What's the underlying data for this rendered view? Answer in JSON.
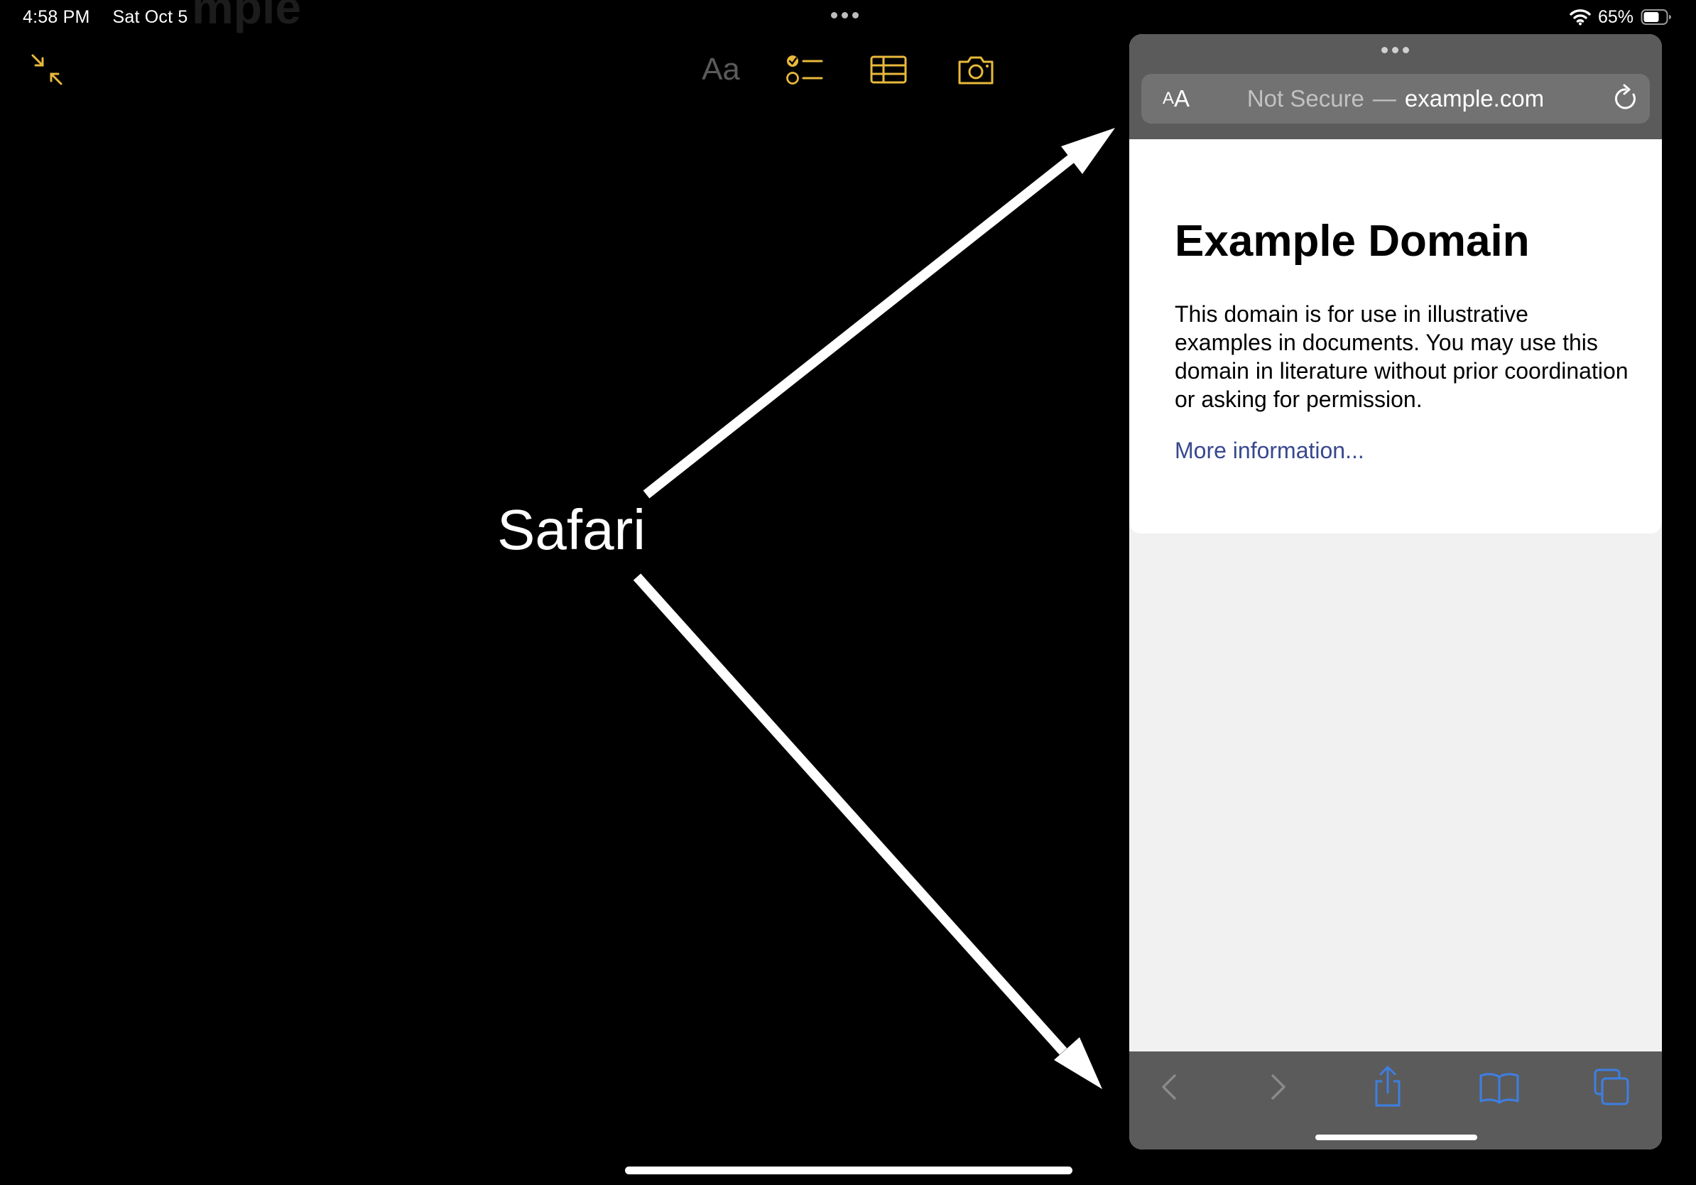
{
  "status_bar": {
    "time": "4:58 PM",
    "date": "Sat Oct 5",
    "battery": "65%",
    "ghost_title": "mple"
  },
  "notes_toolbar": {
    "format_label": "Aa",
    "icons": [
      "collapse-icon",
      "format-icon",
      "checklist-icon",
      "table-icon",
      "camera-icon"
    ],
    "accent_color": "#e8b93a"
  },
  "annotation": {
    "label": "Safari"
  },
  "safari": {
    "address": {
      "reader_small": "A",
      "reader_big": "A",
      "security": "Not Secure",
      "separator": "—",
      "host": "example.com"
    },
    "page": {
      "heading": "Example Domain",
      "paragraph": "This domain is for use in illustrative examples in documents. You may use this domain in literature without prior coordination or asking for permission.",
      "link": "More information..."
    },
    "toolbar": {
      "icons": [
        "back-icon",
        "forward-icon",
        "share-icon",
        "bookmarks-icon",
        "tabs-icon"
      ],
      "tint_color": "#3d7fe3",
      "disabled_color": "#8a8a8a"
    },
    "colors": {
      "chrome": "#5b5b5b",
      "address_field": "#727272",
      "link": "#38488f"
    }
  }
}
